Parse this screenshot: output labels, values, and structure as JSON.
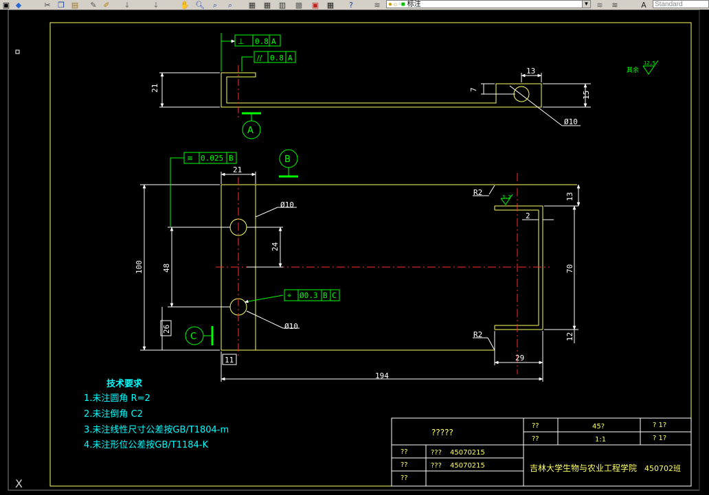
{
  "toolbar": {
    "layer_name": "标注",
    "text_style": "Standard",
    "icons": [
      "new-icon",
      "open-icon",
      "cut-icon",
      "copy-icon",
      "paste-icon",
      "match-properties-icon",
      "brush-icon",
      "undo-icon",
      "redo-icon",
      "pan-icon",
      "zoom-realtime-icon",
      "zoom-window-icon",
      "zoom-previous-icon",
      "properties-icon",
      "design-center-icon",
      "tool-palettes-icon",
      "sheet-set-icon",
      "markup-icon",
      "calculator-icon",
      "help-icon",
      "layer-manager-icon",
      "layer-state-icon",
      "text-style-icon"
    ]
  },
  "drawing": {
    "colors": {
      "yellow": "#ffff66",
      "green": "#00ff00",
      "red": "#ff3030",
      "white": "#ffffff",
      "cyan": "#00ffff"
    },
    "top_view": {
      "tolerance_1": {
        "symbol": "⊥",
        "value": "0.8",
        "datum": "A"
      },
      "tolerance_2": {
        "symbol": "//",
        "value": "0.8",
        "datum": "A"
      },
      "dim_height": "21",
      "dim_hole_offset": "7",
      "dim_width": "13",
      "dim_right_height": "15",
      "hole_dia": "Ø10",
      "datum": "A",
      "roughness_label": "其余",
      "roughness_value": "12.5"
    },
    "front_view": {
      "tolerance_symmetry": {
        "symbol": "≡",
        "value": "0.025",
        "datum": "B"
      },
      "tolerance_position": {
        "symbol": "⌖",
        "value": "Ø0.3",
        "datum1": "B",
        "datum2": "C"
      },
      "datum_b": "B",
      "datum_c": "C",
      "dim_21": "21",
      "dim_hole_top": "Ø10",
      "dim_hole_bottom": "Ø10",
      "dim_24": "24",
      "dim_48": "48",
      "dim_100": "100",
      "dim_26": "26",
      "dim_11": "11",
      "dim_194": "194",
      "dim_29": "29",
      "dim_13": "13",
      "dim_2": "2",
      "dim_70": "70",
      "dim_12": "12",
      "r_top": "R2",
      "r_bottom": "R2",
      "roughness_small": "3.2"
    },
    "notes": {
      "title": "技术要求",
      "lines": [
        "1.未注圆角 R=2",
        "2.未注倒角 C2",
        "3.未注线性尺寸公差按GB/T1804-m",
        "4.未注形位公差按GB/T1184-K"
      ]
    },
    "title_block": {
      "part_name": "?????",
      "r1_label": "??",
      "r1_value": "45?",
      "r1_right": "? 1?",
      "r2_label": "??",
      "r2_value": "1:1",
      "r2_right": "? 1?",
      "row_a_label": "??",
      "row_a_name": "???",
      "row_a_id": "45070215",
      "row_b_label": "??",
      "row_b_name": "???",
      "row_b_id": "45070215",
      "row_c_label": "??",
      "school": "吉林大学生物与农业工程学院",
      "class": "450702班"
    }
  }
}
